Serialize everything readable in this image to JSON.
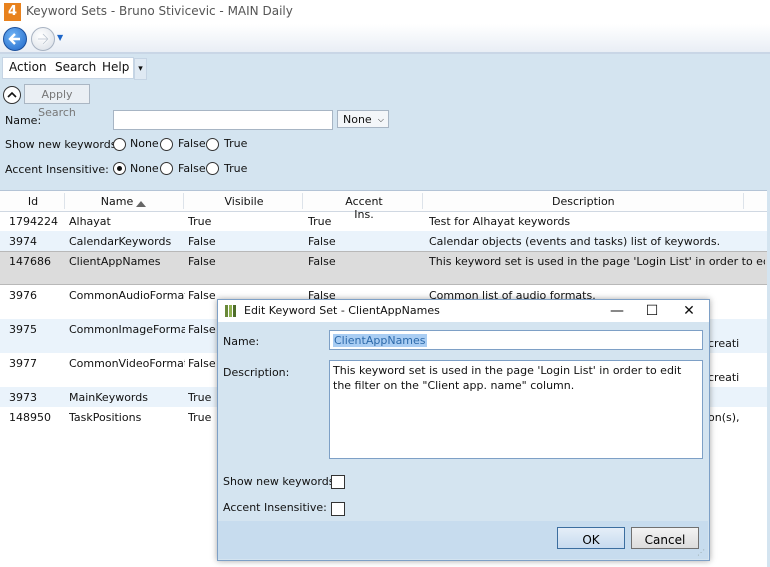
{
  "window": {
    "title": "Keyword Sets - Bruno Stivicevic - MAIN Daily",
    "app_icon_text": "4"
  },
  "menu": {
    "items": [
      "Action",
      "Search",
      "Help"
    ]
  },
  "search": {
    "apply_label": "Apply Search",
    "name_label": "Name:",
    "name_value": "",
    "name_filter_selected": "None",
    "show_new_label": "Show new keywords:",
    "accent_label": "Accent Insensitive:",
    "options": [
      "None",
      "False",
      "True"
    ],
    "show_new_selected": "",
    "accent_selected": "None"
  },
  "grid": {
    "columns": [
      "Id",
      "Name",
      "Visibile",
      "Accent Ins.",
      "Description"
    ],
    "sorted_column": "Name",
    "rows": [
      {
        "id": "1794224",
        "name": "Alhayat",
        "visible": "True",
        "accent": "True",
        "description": "Test for Alhayat keywords"
      },
      {
        "id": "3974",
        "name": "CalendarKeywords",
        "visible": "False",
        "accent": "False",
        "description": "Calendar objects (events and tasks) list of keywords."
      },
      {
        "id": "147686",
        "name": "ClientAppNames",
        "visible": "False",
        "accent": "False",
        "description": "This keyword set is used in the page 'Login List' in order to edit"
      },
      {
        "id": "3976",
        "name": "CommonAudioFormat",
        "visible": "False",
        "accent": "False",
        "description": "Common list of audio formats."
      },
      {
        "id": "3975",
        "name": "CommonImageFormat",
        "visible": "False",
        "accent": "",
        "description": "creati"
      },
      {
        "id": "3977",
        "name": "CommonVideoFormat",
        "visible": "False",
        "accent": "",
        "description": "creati"
      },
      {
        "id": "3973",
        "name": "MainKeywords",
        "visible": "True",
        "accent": "",
        "description": ""
      },
      {
        "id": "148950",
        "name": "TaskPositions",
        "visible": "True",
        "accent": "",
        "description": "on(s),"
      }
    ]
  },
  "dialog": {
    "title": "Edit Keyword Set - ClientAppNames",
    "name_label": "Name:",
    "name_value": "ClientAppNames",
    "description_label": "Description:",
    "description_value": "This keyword set is used in the page 'Login List' in order to edit the filter on the \"Client app. name\" column.",
    "show_new_label": "Show new keywords:",
    "accent_label": "Accent Insensitive:",
    "ok_label": "OK",
    "cancel_label": "Cancel",
    "minimize_glyph": "—",
    "maximize_glyph": "☐",
    "close_glyph": "✕"
  },
  "colors": {
    "accent": "#1e66c8",
    "selection": "#a9cdf3",
    "background": "#d4e4f0"
  }
}
